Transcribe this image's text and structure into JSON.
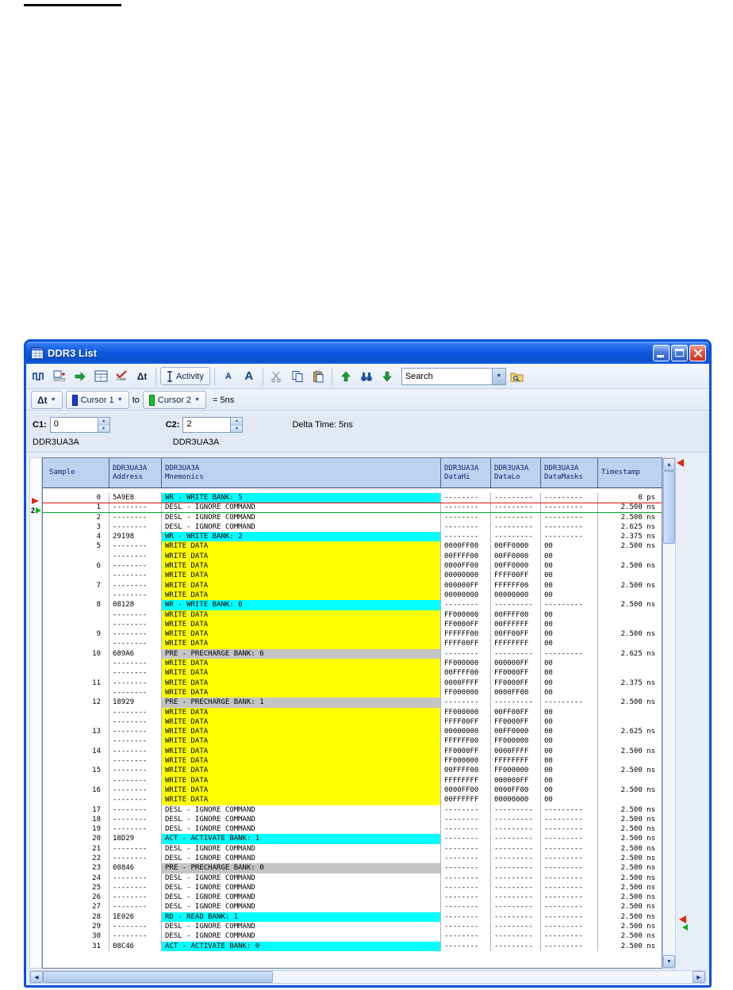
{
  "window": {
    "title": "DDR3 List"
  },
  "toolbar": {
    "activity_label": "Activity",
    "font_small_label": "A",
    "font_large_label": "A",
    "search_value": "Search",
    "goto_icon_label": "GOTO",
    "code_icon_label": "Code",
    "dt_icon_label": "Δt"
  },
  "cursor_bar": {
    "dt_label": "Δt",
    "cursor1_label": "Cursor 1",
    "to_label": "to",
    "cursor2_label": "Cursor 2",
    "delta_label": "= 5ns"
  },
  "cursor_panel": {
    "c1_label": "C1:",
    "c1_value": "0",
    "c2_label": "C2:",
    "c2_value": "2",
    "delta_time_label": "Delta Time: 5ns",
    "c1_bus": "DDR3UA3A",
    "c2_bus": "DDR3UA3A"
  },
  "cursors": {
    "c2_marker_label": "2"
  },
  "icons": {
    "up_arrow": "▲",
    "down_arrow": "▼",
    "left_arrow": "◀",
    "right_arrow": "▶",
    "dropdown_arrow": "▼",
    "spinner_up": "▲",
    "spinner_down": "▼"
  },
  "table": {
    "columns": [
      {
        "l1": "Sample",
        "l2": ""
      },
      {
        "l1": "DDR3UA3A",
        "l2": "Address"
      },
      {
        "l1": "DDR3UA3A",
        "l2": "Mnemonics"
      },
      {
        "l1": "DDR3UA3A",
        "l2": "DataHi"
      },
      {
        "l1": "DDR3UA3A",
        "l2": "DataLo"
      },
      {
        "l1": "DDR3UA3A",
        "l2": "DataMasks"
      },
      {
        "l1": "Timestamp",
        "l2": ""
      }
    ],
    "row_format": [
      "sample",
      "address",
      "mnemonic",
      "highlight",
      "data_hi",
      "data_lo",
      "data_masks",
      "timestamp"
    ],
    "highlight_colors": {
      "cmd": "#00FFFF",
      "data": "#FFFF00",
      "pre": "#C4C4C4"
    },
    "rows": [
      [
        "0",
        "5A9E8",
        "WR - WRITE BANK: 5",
        "cmd",
        "--------",
        "---------",
        "---------",
        "0 ps"
      ],
      [
        "1",
        "--------",
        "DESL - IGNORE COMMAND",
        "",
        "--------",
        "---------",
        "---------",
        "2.500 ns"
      ],
      [
        "2",
        "--------",
        "DESL - IGNORE COMMAND",
        "",
        "--------",
        "---------",
        "---------",
        "2.500 ns"
      ],
      [
        "3",
        "--------",
        "DESL - IGNORE COMMAND",
        "",
        "--------",
        "---------",
        "---------",
        "2.625 ns"
      ],
      [
        "4",
        "29198",
        "WR - WRITE BANK: 2",
        "cmd",
        "--------",
        "---------",
        "---------",
        "2.375 ns"
      ],
      [
        "5",
        "--------",
        "WRITE DATA",
        "data",
        "0000FF00",
        "00FF0000",
        "00",
        "2.500 ns"
      ],
      [
        "",
        "--------",
        "WRITE DATA",
        "data",
        "00FFFF00",
        "00FF0000",
        "00",
        ""
      ],
      [
        "6",
        "--------",
        "WRITE DATA",
        "data",
        "0000FF00",
        "00FF0000",
        "00",
        "2.500 ns"
      ],
      [
        "",
        "--------",
        "WRITE DATA",
        "data",
        "00000000",
        "FFFF00FF",
        "00",
        ""
      ],
      [
        "7",
        "--------",
        "WRITE DATA",
        "data",
        "000000FF",
        "FFFFFF00",
        "00",
        "2.500 ns"
      ],
      [
        "",
        "--------",
        "WRITE DATA",
        "data",
        "00000000",
        "00000000",
        "00",
        ""
      ],
      [
        "8",
        "08128",
        "WR - WRITE BANK: 0",
        "cmd",
        "--------",
        "---------",
        "---------",
        "2.500 ns"
      ],
      [
        "",
        "--------",
        "WRITE DATA",
        "data",
        "FF000000",
        "00FFFF00",
        "00",
        ""
      ],
      [
        "",
        "--------",
        "WRITE DATA",
        "data",
        "FF0000FF",
        "00FFFFFF",
        "00",
        ""
      ],
      [
        "9",
        "--------",
        "WRITE DATA",
        "data",
        "FFFFFF00",
        "00FF00FF",
        "00",
        "2.500 ns"
      ],
      [
        "",
        "--------",
        "WRITE DATA",
        "data",
        "FFFF00FF",
        "FFFFFFFF",
        "00",
        ""
      ],
      [
        "10",
        "689A6",
        "PRE - PRECHARGE BANK: 6",
        "pre",
        "--------",
        "---------",
        "---------",
        "2.625 ns"
      ],
      [
        "",
        "--------",
        "WRITE DATA",
        "data",
        "FF000000",
        "000000FF",
        "00",
        ""
      ],
      [
        "",
        "--------",
        "WRITE DATA",
        "data",
        "00FFFF00",
        "FF0000FF",
        "00",
        ""
      ],
      [
        "11",
        "--------",
        "WRITE DATA",
        "data",
        "0000FFFF",
        "FF0000FF",
        "00",
        "2.375 ns"
      ],
      [
        "",
        "--------",
        "WRITE DATA",
        "data",
        "FF000000",
        "0000FF00",
        "00",
        ""
      ],
      [
        "12",
        "18929",
        "PRE - PRECHARGE BANK: 1",
        "pre",
        "--------",
        "---------",
        "---------",
        "2.500 ns"
      ],
      [
        "",
        "--------",
        "WRITE DATA",
        "data",
        "FF000000",
        "00FF00FF",
        "00",
        ""
      ],
      [
        "",
        "--------",
        "WRITE DATA",
        "data",
        "FFFF00FF",
        "FF0000FF",
        "00",
        ""
      ],
      [
        "13",
        "--------",
        "WRITE DATA",
        "data",
        "00000000",
        "00FF0000",
        "00",
        "2.625 ns"
      ],
      [
        "",
        "--------",
        "WRITE DATA",
        "data",
        "FFFFFF00",
        "FF000000",
        "00",
        ""
      ],
      [
        "14",
        "--------",
        "WRITE DATA",
        "data",
        "FF0000FF",
        "0000FFFF",
        "00",
        "2.500 ns"
      ],
      [
        "",
        "--------",
        "WRITE DATA",
        "data",
        "FF000000",
        "FFFFFFFF",
        "00",
        ""
      ],
      [
        "15",
        "--------",
        "WRITE DATA",
        "data",
        "00FFFF00",
        "FF000000",
        "00",
        "2.500 ns"
      ],
      [
        "",
        "--------",
        "WRITE DATA",
        "data",
        "FFFFFFFF",
        "000000FF",
        "00",
        ""
      ],
      [
        "16",
        "--------",
        "WRITE DATA",
        "data",
        "0000FF00",
        "0000FF00",
        "00",
        "2.500 ns"
      ],
      [
        "",
        "--------",
        "WRITE DATA",
        "data",
        "00FFFFFF",
        "00000000",
        "00",
        ""
      ],
      [
        "17",
        "--------",
        "DESL - IGNORE COMMAND",
        "",
        "--------",
        "---------",
        "---------",
        "2.500 ns"
      ],
      [
        "18",
        "--------",
        "DESL - IGNORE COMMAND",
        "",
        "--------",
        "---------",
        "---------",
        "2.500 ns"
      ],
      [
        "19",
        "--------",
        "DESL - IGNORE COMMAND",
        "",
        "--------",
        "---------",
        "---------",
        "2.500 ns"
      ],
      [
        "20",
        "18D29",
        "ACT - ACTIVATE BANK: 1",
        "cmd",
        "--------",
        "---------",
        "---------",
        "2.500 ns"
      ],
      [
        "21",
        "--------",
        "DESL - IGNORE COMMAND",
        "",
        "--------",
        "---------",
        "---------",
        "2.500 ns"
      ],
      [
        "22",
        "--------",
        "DESL - IGNORE COMMAND",
        "",
        "--------",
        "---------",
        "---------",
        "2.500 ns"
      ],
      [
        "23",
        "08846",
        "PRE - PRECHARGE BANK: 0",
        "pre",
        "--------",
        "---------",
        "---------",
        "2.500 ns"
      ],
      [
        "24",
        "--------",
        "DESL - IGNORE COMMAND",
        "",
        "--------",
        "---------",
        "---------",
        "2.500 ns"
      ],
      [
        "25",
        "--------",
        "DESL - IGNORE COMMAND",
        "",
        "--------",
        "---------",
        "---------",
        "2.500 ns"
      ],
      [
        "26",
        "--------",
        "DESL - IGNORE COMMAND",
        "",
        "--------",
        "---------",
        "---------",
        "2.500 ns"
      ],
      [
        "27",
        "--------",
        "DESL - IGNORE COMMAND",
        "",
        "--------",
        "---------",
        "---------",
        "2.500 ns"
      ],
      [
        "28",
        "1E026",
        "RD - READ BANK: 1",
        "cmd",
        "--------",
        "---------",
        "---------",
        "2.500 ns"
      ],
      [
        "29",
        "--------",
        "DESL - IGNORE COMMAND",
        "",
        "--------",
        "---------",
        "---------",
        "2.500 ns"
      ],
      [
        "30",
        "--------",
        "DESL - IGNORE COMMAND",
        "",
        "--------",
        "---------",
        "---------",
        "2.500 ns"
      ],
      [
        "31",
        "08C46",
        "ACT - ACTIVATE BANK: 0",
        "cmd",
        "--------",
        "---------",
        "---------",
        "2.500 ns"
      ]
    ]
  }
}
